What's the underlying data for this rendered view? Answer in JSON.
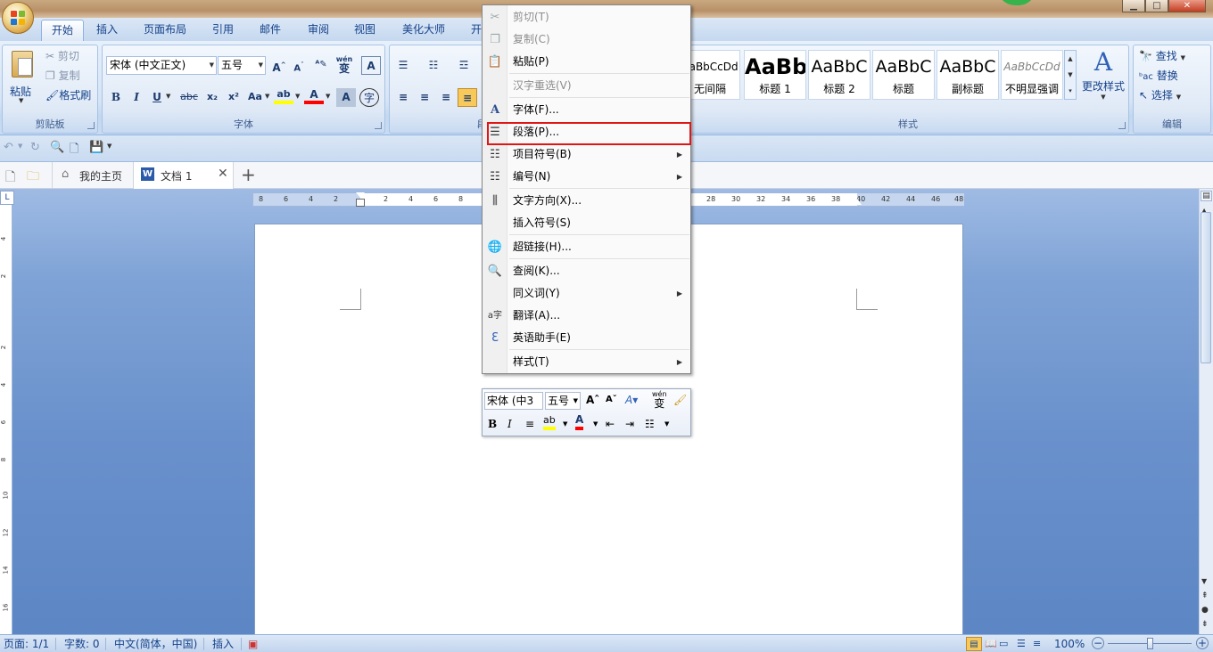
{
  "ribbon_tabs": [
    "开始",
    "插入",
    "页面布局",
    "引用",
    "邮件",
    "审阅",
    "视图",
    "美化大师",
    "开"
  ],
  "clipboard": {
    "paste_label": "粘贴",
    "cut_label": "剪切",
    "copy_label": "复制",
    "format_painter_label": "格式刷",
    "group_label": "剪贴板"
  },
  "font_group": {
    "font_name": "宋体 (中文正文)",
    "font_size": "五号",
    "group_label": "字体",
    "pinyin_label": "wén",
    "bold": "B",
    "italic": "I",
    "underline": "U",
    "strike": "abc",
    "subscript": "x₂",
    "superscript": "x²",
    "change_case": "Aa",
    "highlight_color": "#ffff00",
    "font_color": "#ff0000"
  },
  "paragraph_group": {
    "group_label": "段"
  },
  "styles_group": {
    "group_label": "样式",
    "change_styles_label": "更改样式",
    "items": [
      {
        "preview": "AaBbCcDd",
        "label": "无间隔"
      },
      {
        "preview": "AaBb",
        "label": "标题 1"
      },
      {
        "preview": "AaBbC",
        "label": "标题 2"
      },
      {
        "preview": "AaBbC",
        "label": "标题"
      },
      {
        "preview": "AaBbC",
        "label": "副标题"
      },
      {
        "preview": "AaBbCcDd",
        "label": "不明显强调"
      }
    ]
  },
  "editing_group": {
    "group_label": "编辑",
    "find_label": "查找",
    "replace_label": "替换",
    "select_label": "选择"
  },
  "doc_tabs": {
    "home_tab": "我的主页",
    "doc_tab": "文档 1",
    "add_symbol": "+",
    "close_symbol": "✕"
  },
  "ruler_ticks": [
    "8",
    "6",
    "4",
    "2",
    "2",
    "4",
    "6",
    "8",
    "28",
    "30",
    "32",
    "34",
    "36",
    "38",
    "40",
    "42",
    "44",
    "46",
    "48"
  ],
  "vruler_ticks": [
    "4",
    "2",
    "2",
    "4",
    "6",
    "8",
    "10",
    "12",
    "14",
    "16"
  ],
  "context_menu": {
    "items": [
      {
        "label": "剪切(T)",
        "disabled": true,
        "icon": "scissors-icon"
      },
      {
        "label": "复制(C)",
        "disabled": true,
        "icon": "copy-icon"
      },
      {
        "label": "粘贴(P)",
        "disabled": false,
        "icon": "paste-icon"
      },
      {
        "label": "汉字重选(V)",
        "disabled": true,
        "icon": ""
      },
      {
        "label": "字体(F)...",
        "disabled": false,
        "icon": "font-icon"
      },
      {
        "label": "段落(P)...",
        "disabled": false,
        "icon": "paragraph-icon"
      },
      {
        "label": "项目符号(B)",
        "disabled": false,
        "icon": "bullets-icon",
        "submenu": true
      },
      {
        "label": "编号(N)",
        "disabled": false,
        "icon": "numbering-icon",
        "submenu": true
      },
      {
        "label": "文字方向(X)...",
        "disabled": false,
        "icon": "text-direction-icon"
      },
      {
        "label": "插入符号(S)",
        "disabled": false,
        "icon": ""
      },
      {
        "label": "超链接(H)...",
        "disabled": false,
        "icon": "hyperlink-icon"
      },
      {
        "label": "查阅(K)...",
        "disabled": false,
        "icon": "research-icon"
      },
      {
        "label": "同义词(Y)",
        "disabled": false,
        "icon": "",
        "submenu": true
      },
      {
        "label": "翻译(A)...",
        "disabled": false,
        "icon": "translate-icon"
      },
      {
        "label": "英语助手(E)",
        "disabled": false,
        "icon": "english-assistant-icon"
      },
      {
        "label": "样式(T)",
        "disabled": false,
        "icon": "",
        "submenu": true
      }
    ],
    "highlighted": "段落(P)...",
    "highlight_color": "#e01616"
  },
  "mini_toolbar": {
    "font_name": "宋体 (中3",
    "font_size": "五号",
    "bold": "B",
    "italic": "I",
    "pinyin_label": "wén"
  },
  "status_bar": {
    "page": "页面: 1/1",
    "words": "字数: 0",
    "language": "中文(简体，中国)",
    "mode": "插入",
    "zoom": "100%"
  }
}
